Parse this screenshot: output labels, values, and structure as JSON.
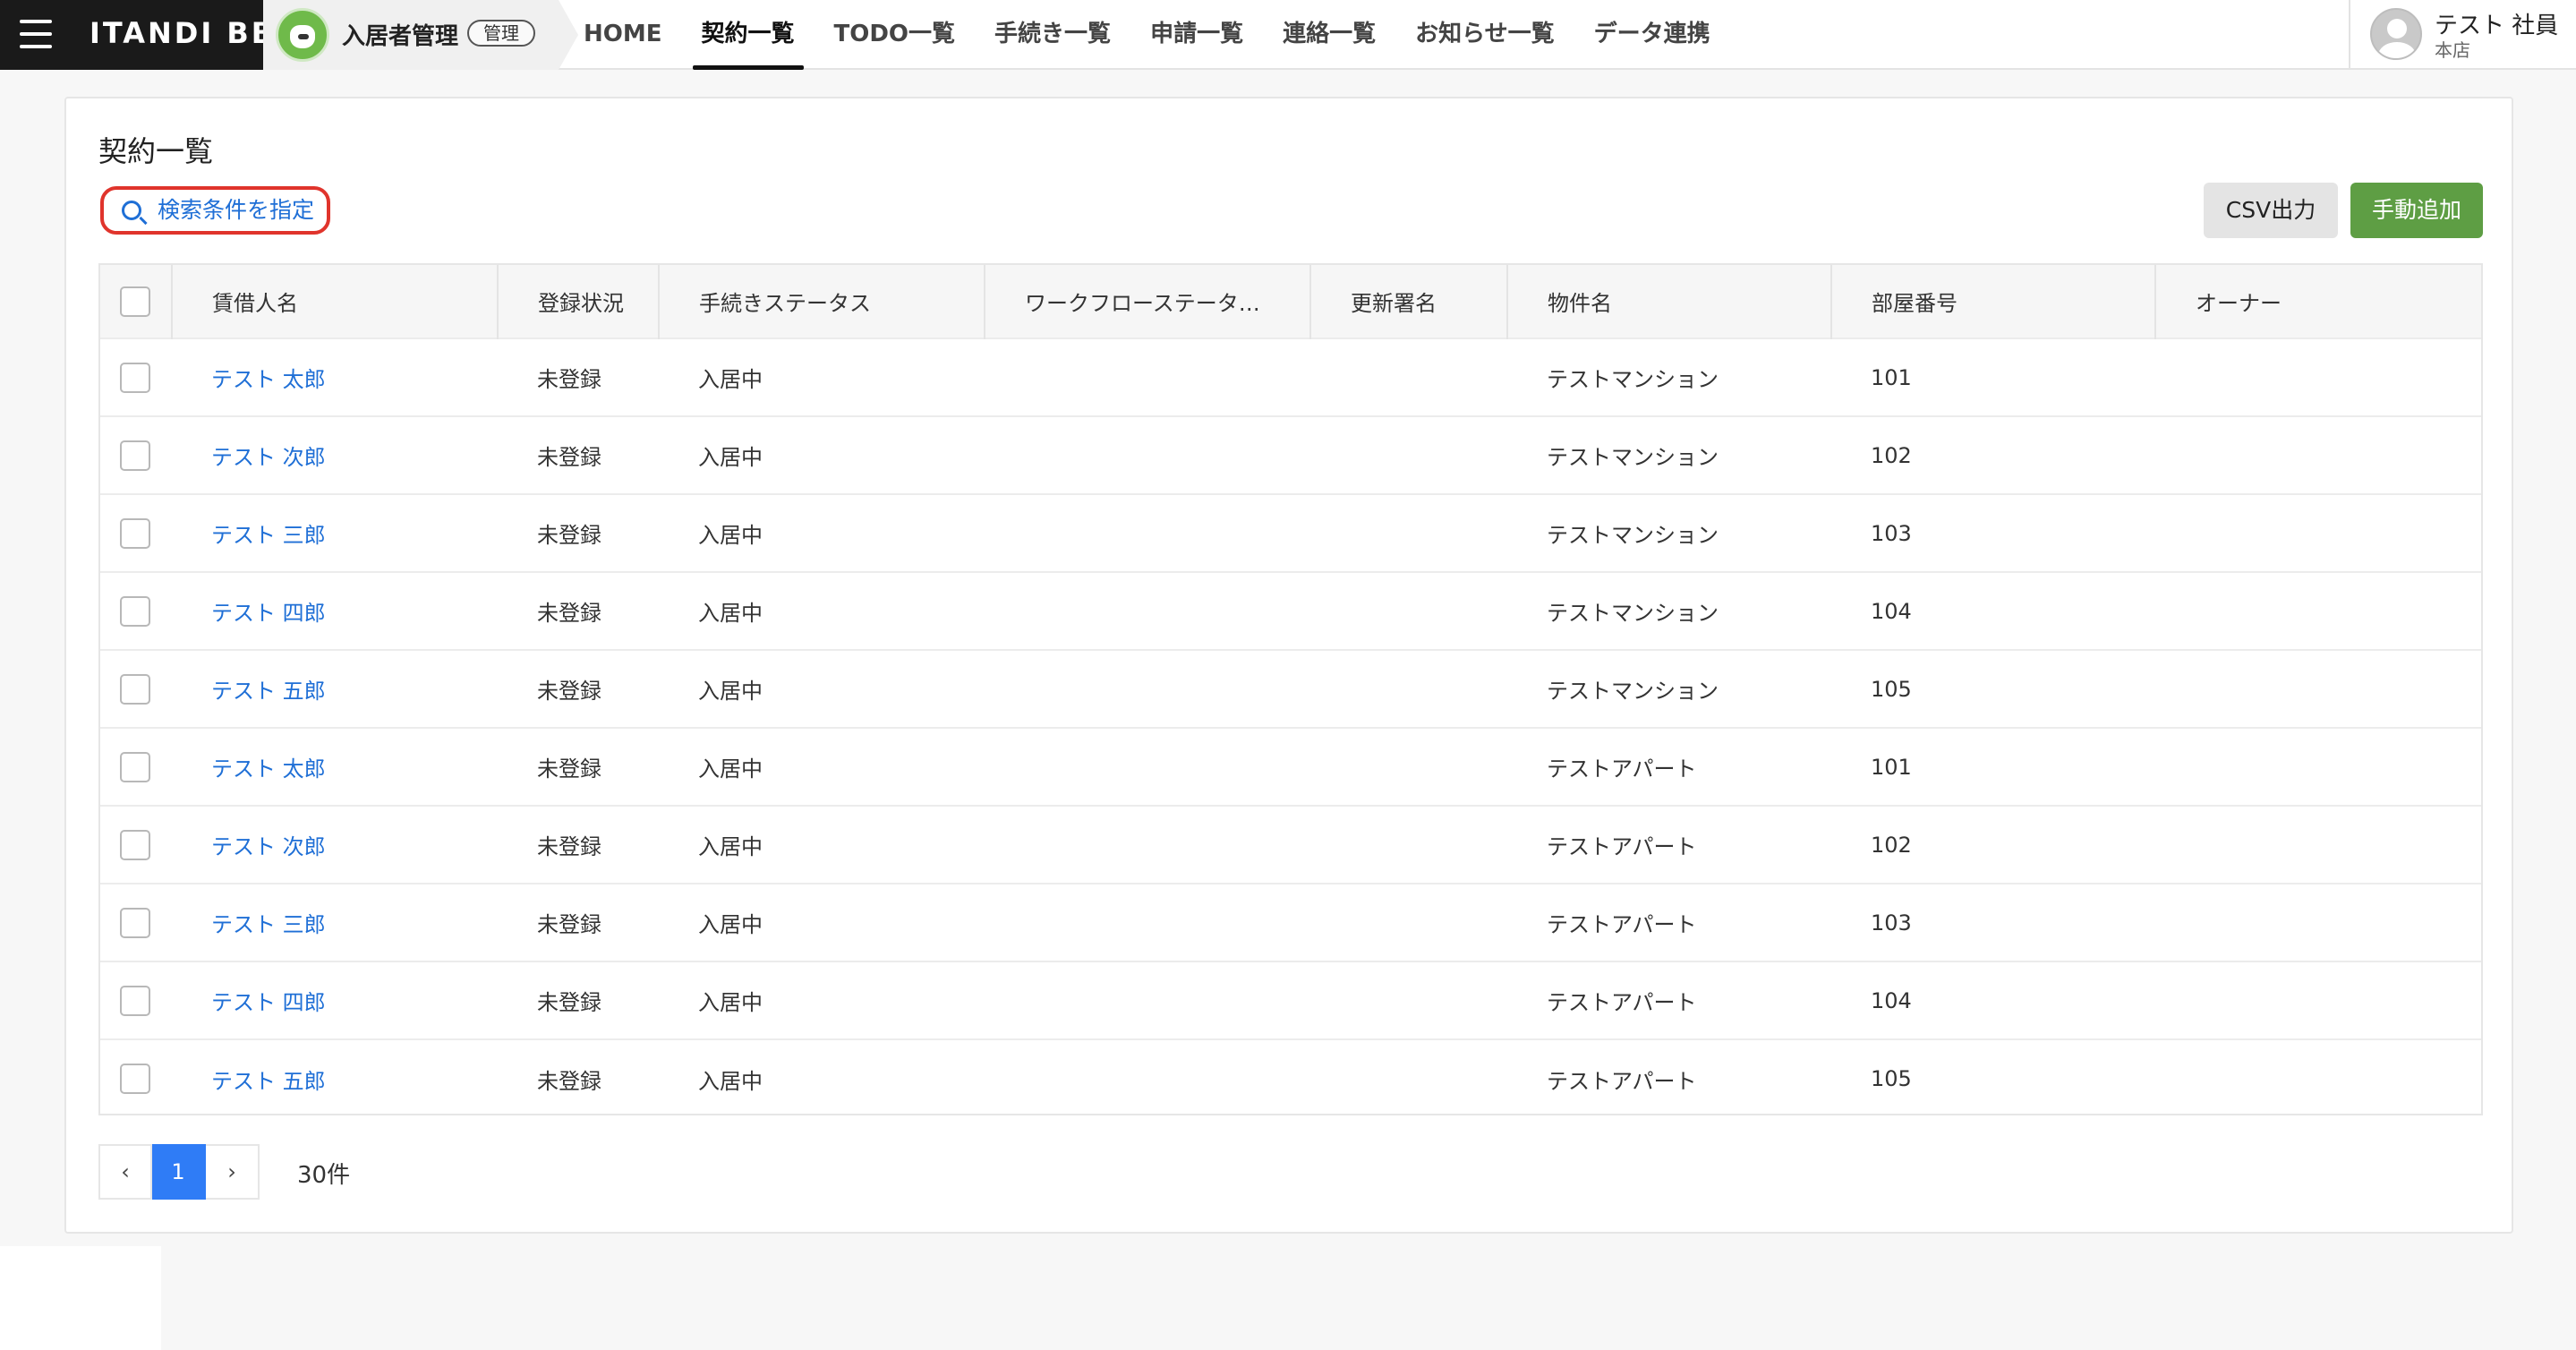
{
  "header": {
    "brand": "ITANDI BB",
    "app": {
      "name": "入居者管理",
      "badge": "管理"
    },
    "nav": [
      {
        "label": "HOME",
        "active": false
      },
      {
        "label": "契約一覧",
        "active": true
      },
      {
        "label": "TODO一覧",
        "active": false
      },
      {
        "label": "手続き一覧",
        "active": false
      },
      {
        "label": "申請一覧",
        "active": false
      },
      {
        "label": "連絡一覧",
        "active": false
      },
      {
        "label": "お知らせ一覧",
        "active": false
      },
      {
        "label": "データ連携",
        "active": false
      }
    ],
    "user": {
      "name": "テスト 社員",
      "branch": "本店"
    }
  },
  "main": {
    "title": "契約一覧",
    "search_label": "検索条件を指定",
    "csv_label": "CSV出力",
    "add_label": "手動追加",
    "table": {
      "columns": [
        "賃借人名",
        "登録状況",
        "手続きステータス",
        "ワークフローステータ…",
        "更新署名",
        "物件名",
        "部屋番号",
        "オーナー"
      ],
      "rows": [
        {
          "name": "テスト 太郎",
          "reg": "未登録",
          "status": "入居中",
          "workflow": "",
          "renewal": "",
          "property": "テストマンション",
          "room": "101",
          "owner": ""
        },
        {
          "name": "テスト 次郎",
          "reg": "未登録",
          "status": "入居中",
          "workflow": "",
          "renewal": "",
          "property": "テストマンション",
          "room": "102",
          "owner": ""
        },
        {
          "name": "テスト 三郎",
          "reg": "未登録",
          "status": "入居中",
          "workflow": "",
          "renewal": "",
          "property": "テストマンション",
          "room": "103",
          "owner": ""
        },
        {
          "name": "テスト 四郎",
          "reg": "未登録",
          "status": "入居中",
          "workflow": "",
          "renewal": "",
          "property": "テストマンション",
          "room": "104",
          "owner": ""
        },
        {
          "name": "テスト 五郎",
          "reg": "未登録",
          "status": "入居中",
          "workflow": "",
          "renewal": "",
          "property": "テストマンション",
          "room": "105",
          "owner": ""
        },
        {
          "name": "テスト 太郎",
          "reg": "未登録",
          "status": "入居中",
          "workflow": "",
          "renewal": "",
          "property": "テストアパート",
          "room": "101",
          "owner": ""
        },
        {
          "name": "テスト 次郎",
          "reg": "未登録",
          "status": "入居中",
          "workflow": "",
          "renewal": "",
          "property": "テストアパート",
          "room": "102",
          "owner": ""
        },
        {
          "name": "テスト 三郎",
          "reg": "未登録",
          "status": "入居中",
          "workflow": "",
          "renewal": "",
          "property": "テストアパート",
          "room": "103",
          "owner": ""
        },
        {
          "name": "テスト 四郎",
          "reg": "未登録",
          "status": "入居中",
          "workflow": "",
          "renewal": "",
          "property": "テストアパート",
          "room": "104",
          "owner": ""
        },
        {
          "name": "テスト 五郎",
          "reg": "未登録",
          "status": "入居中",
          "workflow": "",
          "renewal": "",
          "property": "テストアパート",
          "room": "105",
          "owner": ""
        }
      ]
    },
    "pagination": {
      "prev": "‹",
      "current": "1",
      "next": "›",
      "total": "30件"
    }
  },
  "colors": {
    "accent_blue": "#2f7cf6",
    "link_blue": "#1f6fd6",
    "add_green": "#5e9e44",
    "highlight_red": "#e0342c"
  },
  "icons": {
    "menu": "hamburger-icon",
    "search": "search-icon",
    "avatar": "user-avatar-icon",
    "app": "app-logo-icon"
  }
}
